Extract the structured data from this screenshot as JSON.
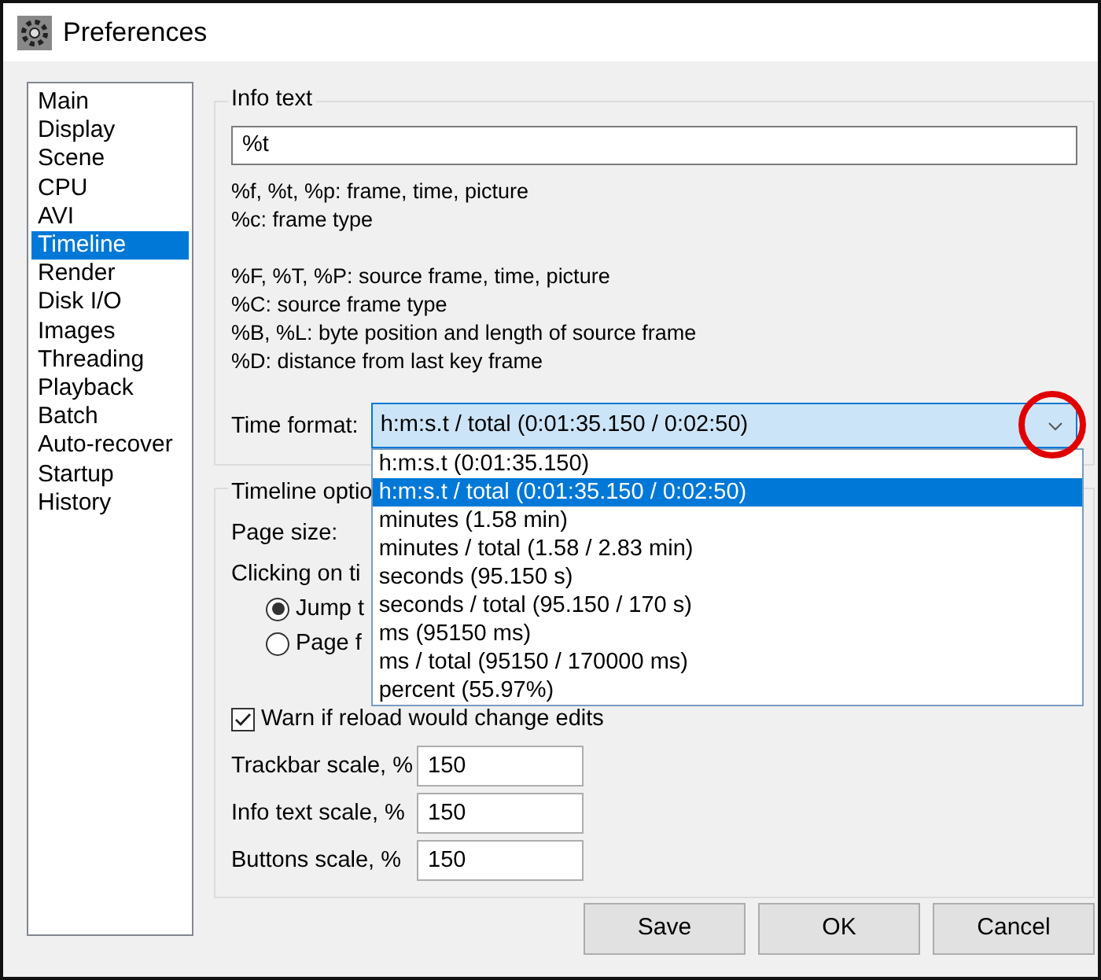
{
  "window": {
    "title": "Preferences"
  },
  "sidebar": {
    "items": [
      {
        "label": "Main",
        "selected": false
      },
      {
        "label": "Display",
        "selected": false
      },
      {
        "label": "Scene",
        "selected": false
      },
      {
        "label": "CPU",
        "selected": false
      },
      {
        "label": "AVI",
        "selected": false
      },
      {
        "label": "Timeline",
        "selected": true
      },
      {
        "label": "Render",
        "selected": false
      },
      {
        "label": "Disk I/O",
        "selected": false
      },
      {
        "label": "Images",
        "selected": false
      },
      {
        "label": "Threading",
        "selected": false
      },
      {
        "label": "Playback",
        "selected": false
      },
      {
        "label": "Batch",
        "selected": false
      },
      {
        "label": "Auto-recover",
        "selected": false
      },
      {
        "label": "Startup",
        "selected": false
      },
      {
        "label": "History",
        "selected": false
      }
    ]
  },
  "info_text": {
    "title": "Info text",
    "value": "%t",
    "help": [
      [
        "%f, %t, %p: frame, time, picture",
        "%c: frame type"
      ],
      [
        "%F, %T, %P: source frame, time, picture",
        "%C: source frame type",
        "%B, %L: byte position and length of source frame",
        "%D: distance from last key frame"
      ]
    ],
    "time_format": {
      "label": "Time format:",
      "value": "h:m:s.t / total (0:01:35.150 / 0:02:50)",
      "expanded": true,
      "highlight_circle": true,
      "options": [
        {
          "label": "h:m:s.t (0:01:35.150)",
          "selected": false
        },
        {
          "label": "h:m:s.t / total (0:01:35.150 / 0:02:50)",
          "selected": true
        },
        {
          "label": "minutes (1.58 min)",
          "selected": false
        },
        {
          "label": "minutes / total (1.58 / 2.83 min)",
          "selected": false
        },
        {
          "label": "seconds (95.150 s)",
          "selected": false
        },
        {
          "label": "seconds / total (95.150 / 170 s)",
          "selected": false
        },
        {
          "label": "ms (95150 ms)",
          "selected": false
        },
        {
          "label": "ms / total (95150 / 170000 ms)",
          "selected": false
        },
        {
          "label": "percent (55.97%)",
          "selected": false
        }
      ]
    }
  },
  "timeline_options": {
    "title": "Timeline optio",
    "page_size_label": "Page size:",
    "clicking_label": "Clicking on ti",
    "radios": [
      {
        "label": "Jump t",
        "selected": true
      },
      {
        "label": "Page f",
        "selected": false
      }
    ],
    "warn": {
      "label": "Warn if reload would change edits",
      "checked": true
    },
    "fields": [
      {
        "label": "Trackbar scale, %",
        "value": "150"
      },
      {
        "label": "Info text scale, %",
        "value": "150"
      },
      {
        "label": "Buttons scale, %",
        "value": "150"
      }
    ]
  },
  "buttons": [
    "Save",
    "OK",
    "Cancel"
  ]
}
